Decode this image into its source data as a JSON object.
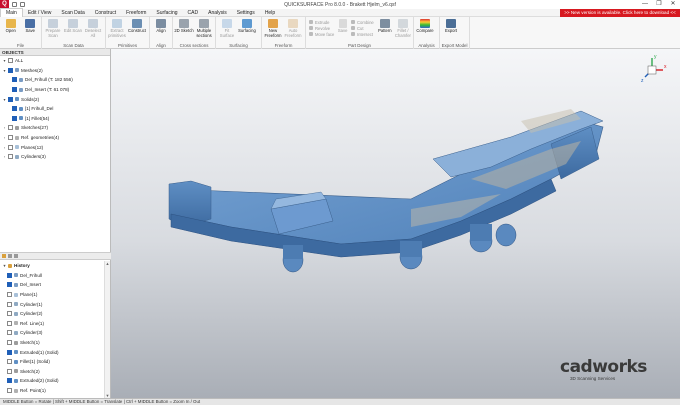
{
  "window": {
    "title": "QUICKSURFACE Pro 8.0.0 - Brakett Hjelm_v6.qsf",
    "minimize": "—",
    "maximize": "❐",
    "close": "✕"
  },
  "menu": {
    "items": [
      "Main",
      "Edit / View",
      "Scan Data",
      "Construct",
      "Freeform",
      "Surfacing",
      "CAD",
      "Analysis",
      "Settings",
      "Help"
    ],
    "update_banner": ">> New version is available. Click here to download <<"
  },
  "ribbon": {
    "file": {
      "label": "File",
      "open": "Open",
      "save": "Save"
    },
    "scan_data": {
      "label": "Scan Data",
      "prepare": "Prepare Scan",
      "edit": "Edit Scan",
      "deselect": "Deselect All"
    },
    "primitives": {
      "label": "Primitives",
      "extract": "Extract primitives",
      "construct": "Construct"
    },
    "align": {
      "label": "Align",
      "align": "Align"
    },
    "cross_sections": {
      "label": "Cross sections",
      "sketch2d": "2D Sketch",
      "multiple": "Multiple sections"
    },
    "surfacing": {
      "label": "Surfacing",
      "fit": "Fit Surface",
      "surfacing": "Surfacing"
    },
    "freeform": {
      "label": "Freeform",
      "new": "New Freeform",
      "auto": "Auto Freeform"
    },
    "part_design": {
      "label": "Part Design",
      "col1": [
        "Extrude",
        "Revolve",
        "Move face"
      ],
      "save": "Save",
      "col2": [
        "Combine",
        "Cut",
        "Intersect"
      ],
      "pattern": "Pattern",
      "fillet": "Fillet / Chamfer"
    },
    "analysis": {
      "label": "Analysis",
      "compare": "Compare"
    },
    "export_model": {
      "label": "Export Model",
      "export": "Export"
    }
  },
  "objects_panel": {
    "title": "OBJECTS",
    "all": "ALL",
    "meshes": "Meshes(2)",
    "mesh_items": [
      "Del_Frihull (T: 182 556)",
      "Del_Insert (T: 61 078)"
    ],
    "solids": "Solids(2)",
    "solid_items": [
      "[1] Frihull_Del",
      "[1] Fillet(54)"
    ],
    "others": [
      "Sketches(27)",
      "Ref. geometries(4)",
      "Planes(12)",
      "Cylinders(3)"
    ]
  },
  "history_panel": {
    "title": "History",
    "items": [
      {
        "label": "Del_Frihull",
        "checked": true
      },
      {
        "label": "Del_Insert",
        "checked": true
      },
      {
        "label": "Plane(1)",
        "checked": false
      },
      {
        "label": "Cylinder(1)",
        "checked": false
      },
      {
        "label": "Cylinder(2)",
        "checked": false
      },
      {
        "label": "Ref. Line(1)",
        "checked": false
      },
      {
        "label": "Cylinder(3)",
        "checked": false
      },
      {
        "label": "Sketch(1)",
        "checked": false
      },
      {
        "label": "Extruded(1) (Solid)",
        "checked": true
      },
      {
        "label": "Fillet(1) (Solid)",
        "checked": false
      },
      {
        "label": "Sketch(2)",
        "checked": false
      },
      {
        "label": "Extruded(2) (Solid)",
        "checked": true
      },
      {
        "label": "Ref. Point(1)",
        "checked": false
      }
    ]
  },
  "viewport": {
    "brand_name": "cadworks",
    "brand_tagline": "3D Scanning Services",
    "triad_axes": [
      "x",
      "y",
      "z"
    ]
  },
  "status": "MIDDLE Button = Rotate | Shift + MIDDLE Button = Translate | Ctrl + MIDDLE Button = Zoom In / Out",
  "colors": {
    "brand_red": "#d71920",
    "accent_blue": "#1f5fb8",
    "model_blue": "#5f8fc4"
  }
}
